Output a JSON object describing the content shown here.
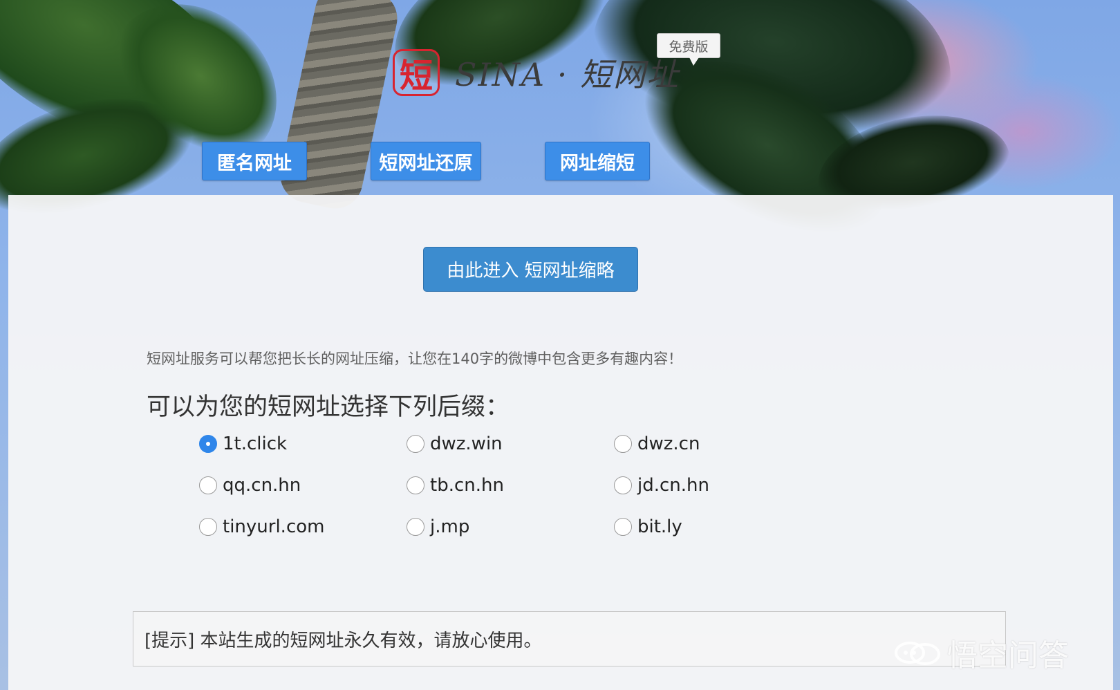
{
  "logo": {
    "seal_char": "短",
    "text": "SINA · 短网址",
    "badge": "免费版"
  },
  "nav": {
    "anonymous": "匿名网址",
    "restore": "短网址还原",
    "shorten": "网址缩短"
  },
  "main": {
    "enter_button": "由此进入 短网址缩略",
    "intro": "短网址服务可以帮您把长长的网址压缩，让您在140字的微博中包含更多有趣内容！",
    "heading": "可以为您的短网址选择下列后缀：",
    "suffixes": [
      {
        "label": "1t.click",
        "checked": true
      },
      {
        "label": "dwz.win",
        "checked": false
      },
      {
        "label": "dwz.cn",
        "checked": false
      },
      {
        "label": "qq.cn.hn",
        "checked": false
      },
      {
        "label": "tb.cn.hn",
        "checked": false
      },
      {
        "label": "jd.cn.hn",
        "checked": false
      },
      {
        "label": "tinyurl.com",
        "checked": false
      },
      {
        "label": "j.mp",
        "checked": false
      },
      {
        "label": "bit.ly",
        "checked": false
      }
    ],
    "tip": "[提示] 本站生成的短网址永久有效，请放心使用。"
  },
  "watermark": {
    "text": "悟空问答"
  },
  "colors": {
    "nav_button": "#3d8ee8",
    "enter_button": "#3c8ccf",
    "seal_red": "#d8242f",
    "radio_checked": "#2f86ea"
  }
}
